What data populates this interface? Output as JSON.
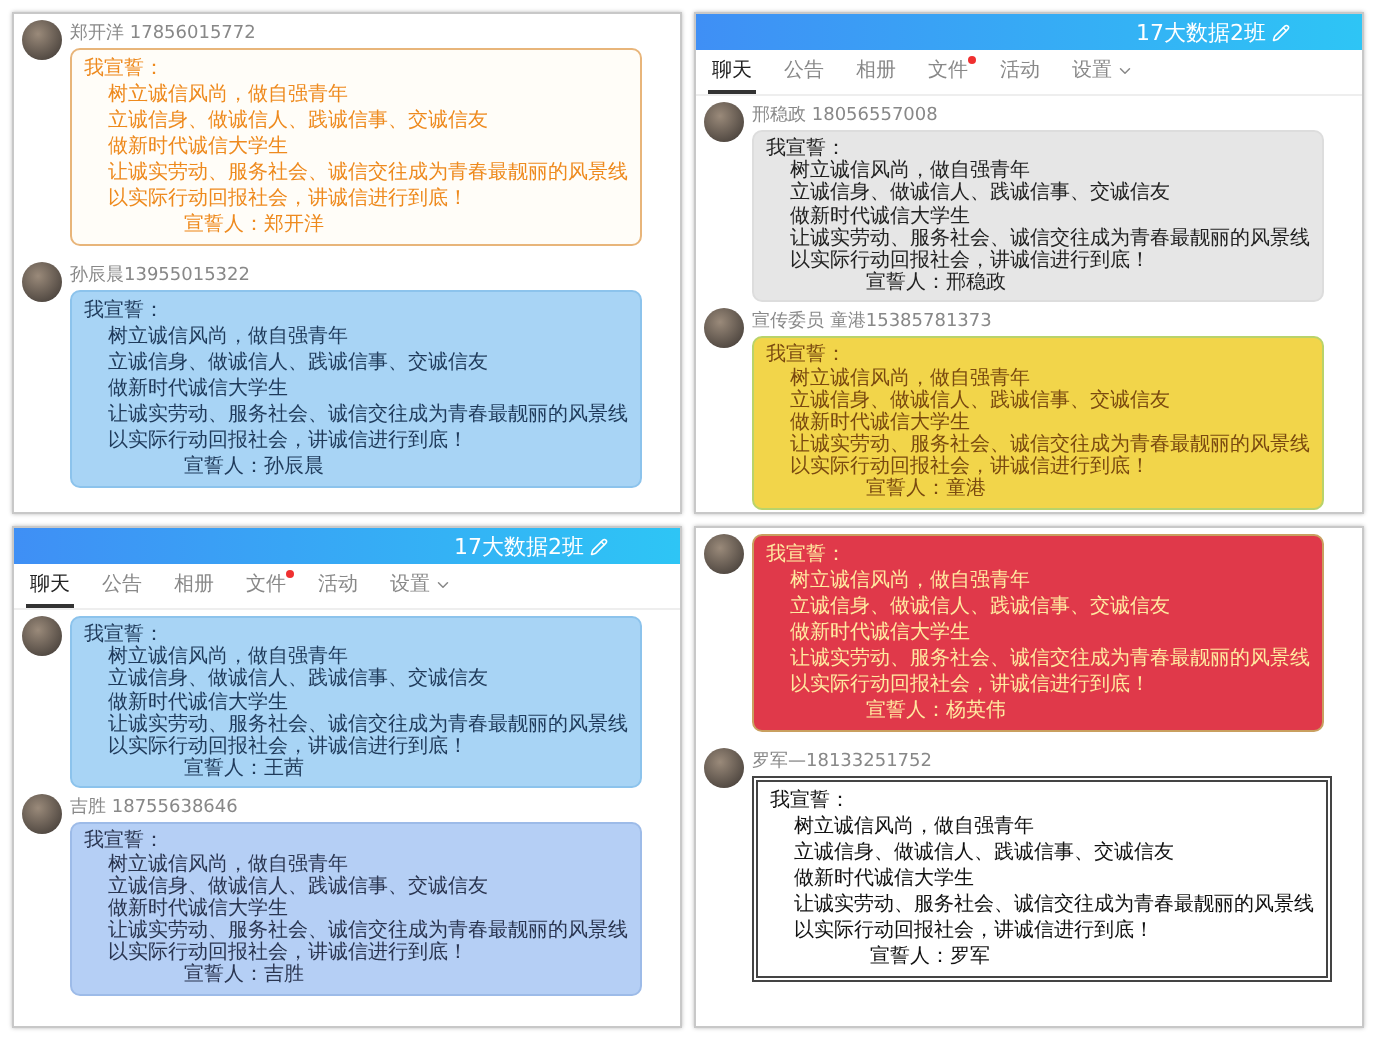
{
  "columns": [
    {
      "panels": [
        {
          "kind": "plain",
          "messages": [
            {
              "kind": "orange-outline",
              "sender": "郑开洋 17856015772",
              "greeting": "我宣誓：",
              "lines": [
                "树立诚信风尚，做自强青年",
                "立诚信身、做诚信人、践诚信事、交诚信友",
                "做新时代诚信大学生",
                "让诚实劳动、服务社会、诚信交往成为青春最靓丽的风景线",
                "以实际行动回报社会，讲诚信进行到底！"
              ],
              "signature": "宣誓人：郑开洋"
            },
            {
              "kind": "sky",
              "sender": "孙辰晨13955015322",
              "greeting": "我宣誓：",
              "lines": [
                "树立诚信风尚，做自强青年",
                "立诚信身、做诚信人、践诚信事、交诚信友",
                "做新时代诚信大学生",
                "让诚实劳动、服务社会、诚信交往成为青春最靓丽的风景线",
                "以实际行动回报社会，讲诚信进行到底！"
              ],
              "signature": "宣誓人：孙辰晨"
            }
          ]
        },
        {
          "kind": "group",
          "title": "17大数据2班",
          "tabs": [
            {
              "label": "聊天",
              "selected": true,
              "unread": false,
              "dropdown": false
            },
            {
              "label": "公告",
              "selected": false,
              "unread": false,
              "dropdown": false
            },
            {
              "label": "相册",
              "selected": false,
              "unread": false,
              "dropdown": false
            },
            {
              "label": "文件",
              "selected": false,
              "unread": true,
              "dropdown": false
            },
            {
              "label": "活动",
              "selected": false,
              "unread": false,
              "dropdown": false
            },
            {
              "label": "设置",
              "selected": false,
              "unread": false,
              "dropdown": true
            }
          ],
          "messages": [
            {
              "kind": "sky",
              "greeting": "我宣誓：",
              "lines": [
                "树立诚信风尚，做自强青年",
                "立诚信身、做诚信人、践诚信事、交诚信友",
                "做新时代诚信大学生",
                "让诚实劳动、服务社会、诚信交往成为青春最靓丽的风景线",
                "以实际行动回报社会，讲诚信进行到底！"
              ],
              "signature": "宣誓人：王茜"
            },
            {
              "kind": "lavender",
              "sender": "吉胜 18755638646",
              "greeting": "我宣誓：",
              "lines": [
                "树立诚信风尚，做自强青年",
                "立诚信身、做诚信人、践诚信事、交诚信友",
                "做新时代诚信大学生",
                "让诚实劳动、服务社会、诚信交往成为青春最靓丽的风景线",
                "以实际行动回报社会，讲诚信进行到底！"
              ],
              "signature": "宣誓人：吉胜"
            }
          ]
        }
      ]
    },
    {
      "panels": [
        {
          "kind": "group",
          "title": "17大数据2班",
          "tabs": [
            {
              "label": "聊天",
              "selected": true,
              "unread": false,
              "dropdown": false
            },
            {
              "label": "公告",
              "selected": false,
              "unread": false,
              "dropdown": false
            },
            {
              "label": "相册",
              "selected": false,
              "unread": false,
              "dropdown": false
            },
            {
              "label": "文件",
              "selected": false,
              "unread": true,
              "dropdown": false
            },
            {
              "label": "活动",
              "selected": false,
              "unread": false,
              "dropdown": false
            },
            {
              "label": "设置",
              "selected": false,
              "unread": false,
              "dropdown": true
            }
          ],
          "messages": [
            {
              "kind": "grey",
              "sender": "邢稳政 18056557008",
              "greeting": "我宣誓：",
              "lines": [
                "树立诚信风尚，做自强青年",
                "立诚信身、做诚信人、践诚信事、交诚信友",
                "做新时代诚信大学生",
                "让诚实劳动、服务社会、诚信交往成为青春最靓丽的风景线",
                "以实际行动回报社会，讲诚信进行到底！"
              ],
              "signature": "宣誓人：邢稳政"
            },
            {
              "kind": "yellow",
              "sender": "宣传委员 童港15385781373",
              "greeting": "我宣誓：",
              "lines": [
                "树立诚信风尚，做自强青年",
                "立诚信身、做诚信人、践诚信事、交诚信友",
                "做新时代诚信大学生",
                "让诚实劳动、服务社会、诚信交往成为青春最靓丽的风景线",
                "以实际行动回报社会，讲诚信进行到底！"
              ],
              "signature": "宣誓人：童港"
            }
          ]
        },
        {
          "kind": "plain",
          "messages": [
            {
              "kind": "red",
              "greeting": "我宣誓：",
              "lines": [
                "树立诚信风尚，做自强青年",
                "立诚信身、做诚信人、践诚信事、交诚信友",
                "做新时代诚信大学生",
                "让诚实劳动、服务社会、诚信交往成为青春最靓丽的风景线",
                "以实际行动回报社会，讲诚信进行到底！"
              ],
              "signature": "宣誓人：杨英伟"
            },
            {
              "kind": "frame",
              "sender": "罗军—18133251752",
              "greeting": "我宣誓：",
              "lines": [
                "树立诚信风尚，做自强青年",
                "立诚信身、做诚信人、践诚信事、交诚信友",
                "做新时代诚信大学生",
                "让诚实劳动、服务社会、诚信交往成为青春最靓丽的风景线",
                "以实际行动回报社会，讲诚信进行到底！"
              ],
              "signature": "宣誓人：罗军"
            }
          ]
        }
      ]
    }
  ]
}
